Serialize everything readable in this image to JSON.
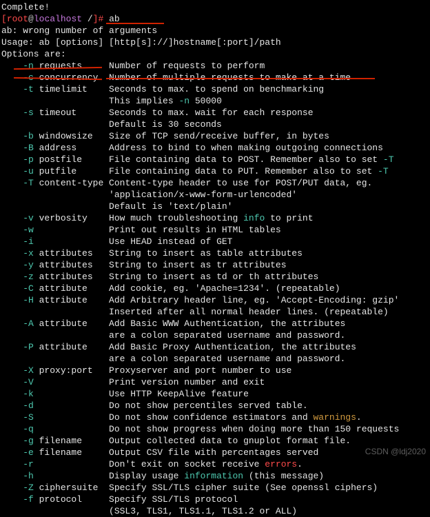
{
  "prompt": {
    "complete": "Complete!",
    "userhost": {
      "bracket_open": "[",
      "user": "root",
      "at": "@",
      "host": "localhost",
      "path": " /",
      "bracket_close": "]# ",
      "cmd": "ab"
    }
  },
  "error": "ab: wrong number of arguments",
  "usage": "Usage: ab [options] [http[s]://]hostname[:port]/path",
  "options_header": "Options are:",
  "options": [
    {
      "flag": "-n",
      "arg": "requests",
      "desc": "Number of requests to perform"
    },
    {
      "flag": "-c",
      "arg": "concurrency",
      "desc": "Number of multiple requests to make at a time"
    },
    {
      "flag": "-t",
      "arg": "timelimit",
      "desc": "Seconds to max. to spend on benchmarking"
    },
    {
      "flag": "",
      "arg": "",
      "desc_parts": [
        "This implies ",
        {
          "cls": "cyan",
          "txt": "-n"
        },
        " 50000"
      ]
    },
    {
      "flag": "-s",
      "arg": "timeout",
      "desc": "Seconds to max. wait for each response"
    },
    {
      "flag": "",
      "arg": "",
      "desc": "Default is 30 seconds"
    },
    {
      "flag": "-b",
      "arg": "windowsize",
      "desc": "Size of TCP send/receive buffer, in bytes"
    },
    {
      "flag": "-B",
      "arg": "address",
      "desc": "Address to bind to when making outgoing connections"
    },
    {
      "flag": "-p",
      "arg": "postfile",
      "desc_parts": [
        "File containing data to POST. Remember also to set ",
        {
          "cls": "cyan",
          "txt": "-T"
        }
      ]
    },
    {
      "flag": "-u",
      "arg": "putfile",
      "desc_parts": [
        "File containing data to PUT. Remember also to set ",
        {
          "cls": "cyan",
          "txt": "-T"
        }
      ]
    },
    {
      "flag": "-T",
      "arg": "content-type",
      "desc": "Content-type header to use for POST/PUT data, eg."
    },
    {
      "flag": "",
      "arg": "",
      "desc": "'application/x-www-form-urlencoded'"
    },
    {
      "flag": "",
      "arg": "",
      "desc": "Default is 'text/plain'"
    },
    {
      "flag": "-v",
      "arg": "verbosity",
      "desc_parts": [
        "How much troubleshooting ",
        {
          "cls": "cyan",
          "txt": "info"
        },
        " to print"
      ]
    },
    {
      "flag": "-w",
      "arg": "",
      "desc": "Print out results in HTML tables"
    },
    {
      "flag": "-i",
      "arg": "",
      "desc": "Use HEAD instead of GET"
    },
    {
      "flag": "-x",
      "arg": "attributes",
      "desc": "String to insert as table attributes"
    },
    {
      "flag": "-y",
      "arg": "attributes",
      "desc": "String to insert as tr attributes"
    },
    {
      "flag": "-z",
      "arg": "attributes",
      "desc": "String to insert as td or th attributes"
    },
    {
      "flag": "-C",
      "arg": "attribute",
      "desc": "Add cookie, eg. 'Apache=1234'. (repeatable)"
    },
    {
      "flag": "-H",
      "arg": "attribute",
      "desc": "Add Arbitrary header line, eg. 'Accept-Encoding: gzip'"
    },
    {
      "flag": "",
      "arg": "",
      "desc": "Inserted after all normal header lines. (repeatable)"
    },
    {
      "flag": "-A",
      "arg": "attribute",
      "desc": "Add Basic WWW Authentication, the attributes"
    },
    {
      "flag": "",
      "arg": "",
      "desc": "are a colon separated username and password."
    },
    {
      "flag": "-P",
      "arg": "attribute",
      "desc": "Add Basic Proxy Authentication, the attributes"
    },
    {
      "flag": "",
      "arg": "",
      "desc": "are a colon separated username and password."
    },
    {
      "flag": "-X",
      "arg": "proxy:port",
      "desc": "Proxyserver and port number to use"
    },
    {
      "flag": "-V",
      "arg": "",
      "desc": "Print version number and exit"
    },
    {
      "flag": "-k",
      "arg": "",
      "desc": "Use HTTP KeepAlive feature"
    },
    {
      "flag": "-d",
      "arg": "",
      "desc": "Do not show percentiles served table."
    },
    {
      "flag": "-S",
      "arg": "",
      "desc_parts": [
        "Do not show confidence estimators and ",
        {
          "cls": "yellow",
          "txt": "warnings"
        },
        "."
      ]
    },
    {
      "flag": "-q",
      "arg": "",
      "desc": "Do not show progress when doing more than 150 requests"
    },
    {
      "flag": "-g",
      "arg": "filename",
      "desc": "Output collected data to gnuplot format file."
    },
    {
      "flag": "-e",
      "arg": "filename",
      "desc": "Output CSV file with percentages served"
    },
    {
      "flag": "-r",
      "arg": "",
      "desc_parts": [
        "Don't exit on socket receive ",
        {
          "cls": "red",
          "txt": "errors"
        },
        "."
      ]
    },
    {
      "flag": "-h",
      "arg": "",
      "desc_parts": [
        "Display usage ",
        {
          "cls": "cyan",
          "txt": "information"
        },
        " (this message)"
      ]
    },
    {
      "flag": "-Z",
      "arg": "ciphersuite",
      "desc": "Specify SSL/TLS cipher suite (See openssl ciphers)"
    },
    {
      "flag": "-f",
      "arg": "protocol",
      "desc": "Specify SSL/TLS protocol"
    },
    {
      "flag": "",
      "arg": "",
      "desc": "(SSL3, TLS1, TLS1.1, TLS1.2 or ALL)"
    }
  ],
  "watermark": "CSDN @ldj2020"
}
